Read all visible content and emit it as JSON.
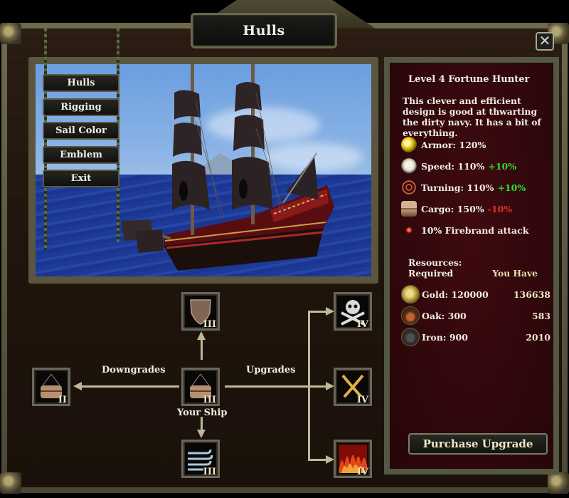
{
  "window": {
    "title": "Hulls",
    "close_label": "✕"
  },
  "menu": {
    "items": [
      {
        "label": "Hulls"
      },
      {
        "label": "Rigging"
      },
      {
        "label": "Sail Color"
      },
      {
        "label": "Emblem"
      },
      {
        "label": "Exit"
      }
    ]
  },
  "info": {
    "ship_name": "Level 4 Fortune Hunter",
    "description": "This clever and efficient design is good at thwarting the dirty navy. It has a bit of everything.",
    "stats": [
      {
        "icon": "armor-icon",
        "label": "Armor: 120%",
        "delta": "",
        "delta_type": ""
      },
      {
        "icon": "speed-icon",
        "label": "Speed: 110%",
        "delta": "+10%",
        "delta_type": "positive"
      },
      {
        "icon": "turning-icon",
        "label": "Turning: 110%",
        "delta": "+10%",
        "delta_type": "positive"
      },
      {
        "icon": "cargo-icon",
        "label": "Cargo: 150%",
        "delta": "-10%",
        "delta_type": "negative"
      },
      {
        "icon": "firebrand-icon",
        "label": "10% Firebrand attack",
        "delta": "",
        "delta_type": ""
      }
    ],
    "colors": {
      "positive": "#2fdc3a",
      "negative": "#e3322c"
    },
    "resources": {
      "header_line1": "Resources:",
      "header_line2": "Required",
      "have_header": "You Have",
      "rows": [
        {
          "icon": "gold-icon",
          "label": "Gold: 120000",
          "have": "136638"
        },
        {
          "icon": "oak-icon",
          "label": "Oak: 300",
          "have": "583"
        },
        {
          "icon": "iron-icon",
          "label": "Iron: 900",
          "have": "2010"
        }
      ]
    },
    "purchase_label": "Purchase Upgrade"
  },
  "tree": {
    "downgrades_label": "Downgrades",
    "upgrades_label": "Upgrades",
    "your_ship_label": "Your Ship",
    "nodes": {
      "current": {
        "tier": "III",
        "icon": "cargo-chest-icon"
      },
      "down": {
        "tier": "II",
        "icon": "cargo-chest-icon"
      },
      "up_armor": {
        "tier": "III",
        "icon": "shield-icon"
      },
      "down_speed": {
        "tier": "III",
        "icon": "wind-icon"
      },
      "upgrade_skull": {
        "tier": "IV",
        "icon": "skull-crossbones-icon"
      },
      "upgrade_swords": {
        "tier": "IV",
        "icon": "crossed-swords-icon"
      },
      "upgrade_fire": {
        "tier": "IV",
        "icon": "fire-icon"
      }
    }
  }
}
